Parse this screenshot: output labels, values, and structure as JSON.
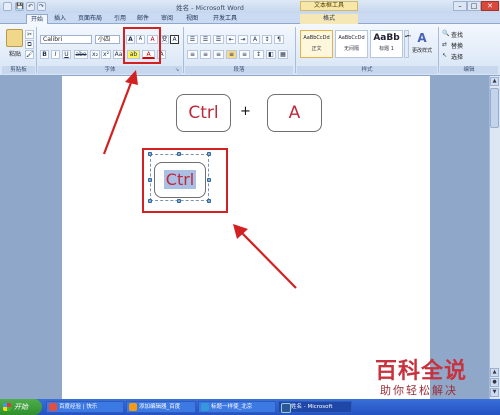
{
  "window": {
    "title": "姓名 - Microsoft Word",
    "tool_title": "文本框工具",
    "qa_save": "💾",
    "qa_undo": "↶",
    "qa_redo": "↷",
    "min": "–",
    "max": "□",
    "close": "✕"
  },
  "tabs": [
    {
      "label": "开始"
    },
    {
      "label": "插入"
    },
    {
      "label": "页面布局"
    },
    {
      "label": "引用"
    },
    {
      "label": "邮件"
    },
    {
      "label": "审阅"
    },
    {
      "label": "视图"
    },
    {
      "label": "开发工具"
    },
    {
      "label": "格式"
    }
  ],
  "ribbon": {
    "clipboard": {
      "paste_label": "粘贴",
      "group": "剪贴板"
    },
    "font": {
      "font_name": "Calibri",
      "font_size": "小四",
      "grow": "A",
      "shrink": "A",
      "clear": "A",
      "phonetic": "变",
      "border_char": "A",
      "bold": "B",
      "italic": "I",
      "underline": "U",
      "strike": "abe",
      "sub": "x₂",
      "sup": "x²",
      "case": "Aa",
      "highlight": "ab",
      "font_color": "A",
      "group": "字体"
    },
    "paragraph": {
      "group": "段落"
    },
    "styles": {
      "items": [
        {
          "sample": "AaBbCcDd",
          "name": "正文"
        },
        {
          "sample": "AaBbCcDd",
          "name": "无间隔"
        },
        {
          "sample": "AaBb",
          "name": "标题 1"
        }
      ],
      "change_styles": "更改样式",
      "group": "样式"
    },
    "editing": {
      "find": "查找",
      "replace": "替换",
      "select": "选择",
      "group": "编辑"
    }
  },
  "document": {
    "key1": "Ctrl",
    "plus": "+",
    "key2": "A",
    "selected_box_text": "Ctrl"
  },
  "taskbar": {
    "start": "开始",
    "tasks": [
      {
        "label": "百度经验 | 快乐"
      },
      {
        "label": "添加编辑器_百度"
      },
      {
        "label": "标题一样使_北京"
      },
      {
        "label": "姓名 - Microsoft"
      }
    ]
  },
  "watermark": {
    "line1": "百科全说",
    "line2": "助你轻松解决"
  },
  "colors": {
    "annotation": "#d32020",
    "key_text": "#c0293a",
    "watermark": "#c8323e"
  }
}
